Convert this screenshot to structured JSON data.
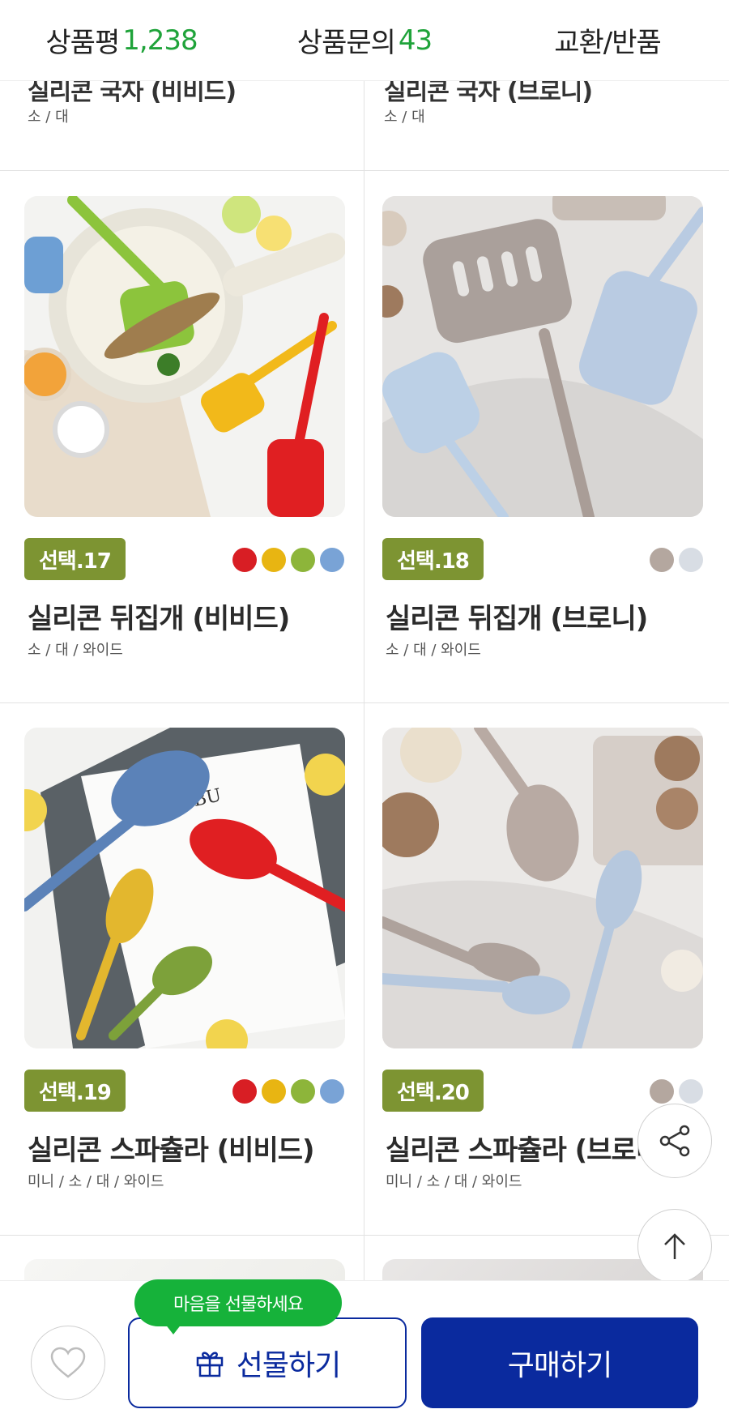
{
  "tabs": [
    {
      "label": "상품평",
      "count": "1,238"
    },
    {
      "label": "상품문의",
      "count": "43"
    },
    {
      "label": "교환/반품",
      "count": ""
    }
  ],
  "partial_row": {
    "left": {
      "title": "실리콘 국자 (비비드)",
      "sizes": "소 / 대"
    },
    "right": {
      "title": "실리콘 국자 (브로니)",
      "sizes": "소 / 대"
    }
  },
  "products": [
    {
      "badge": "선택.17",
      "title": "실리콘 뒤집개 (비비드)",
      "sizes": "소 / 대 / 와이드",
      "colors": [
        "#d81e24",
        "#e8b512",
        "#8db53a",
        "#79a3d6"
      ]
    },
    {
      "badge": "선택.18",
      "title": "실리콘 뒤집개 (브로니)",
      "sizes": "소 / 대 / 와이드",
      "colors": [
        "#b4a79f",
        "#d8dde4"
      ]
    },
    {
      "badge": "선택.19",
      "title": "실리콘 스파츌라 (비비드)",
      "sizes": "미니 / 소 / 대 / 와이드",
      "colors": [
        "#d81e24",
        "#e8b512",
        "#8db53a",
        "#79a3d6"
      ]
    },
    {
      "badge": "선택.20",
      "title": "실리콘 스파츌라 (브로니)",
      "sizes": "미니 / 소 / 대 / 와이드",
      "colors": [
        "#b4a79f",
        "#d8dde4"
      ]
    }
  ],
  "image_text": {
    "malibu": "MALIBU"
  },
  "bottom_bar": {
    "bubble": "마음을 선물하세요",
    "gift_label": "선물하기",
    "buy_label": "구매하기"
  },
  "colors": {
    "accent_green": "#1fa33a",
    "badge_green": "#7d9432",
    "primary_blue": "#0a2a9e",
    "bubble_green": "#16b23a"
  }
}
